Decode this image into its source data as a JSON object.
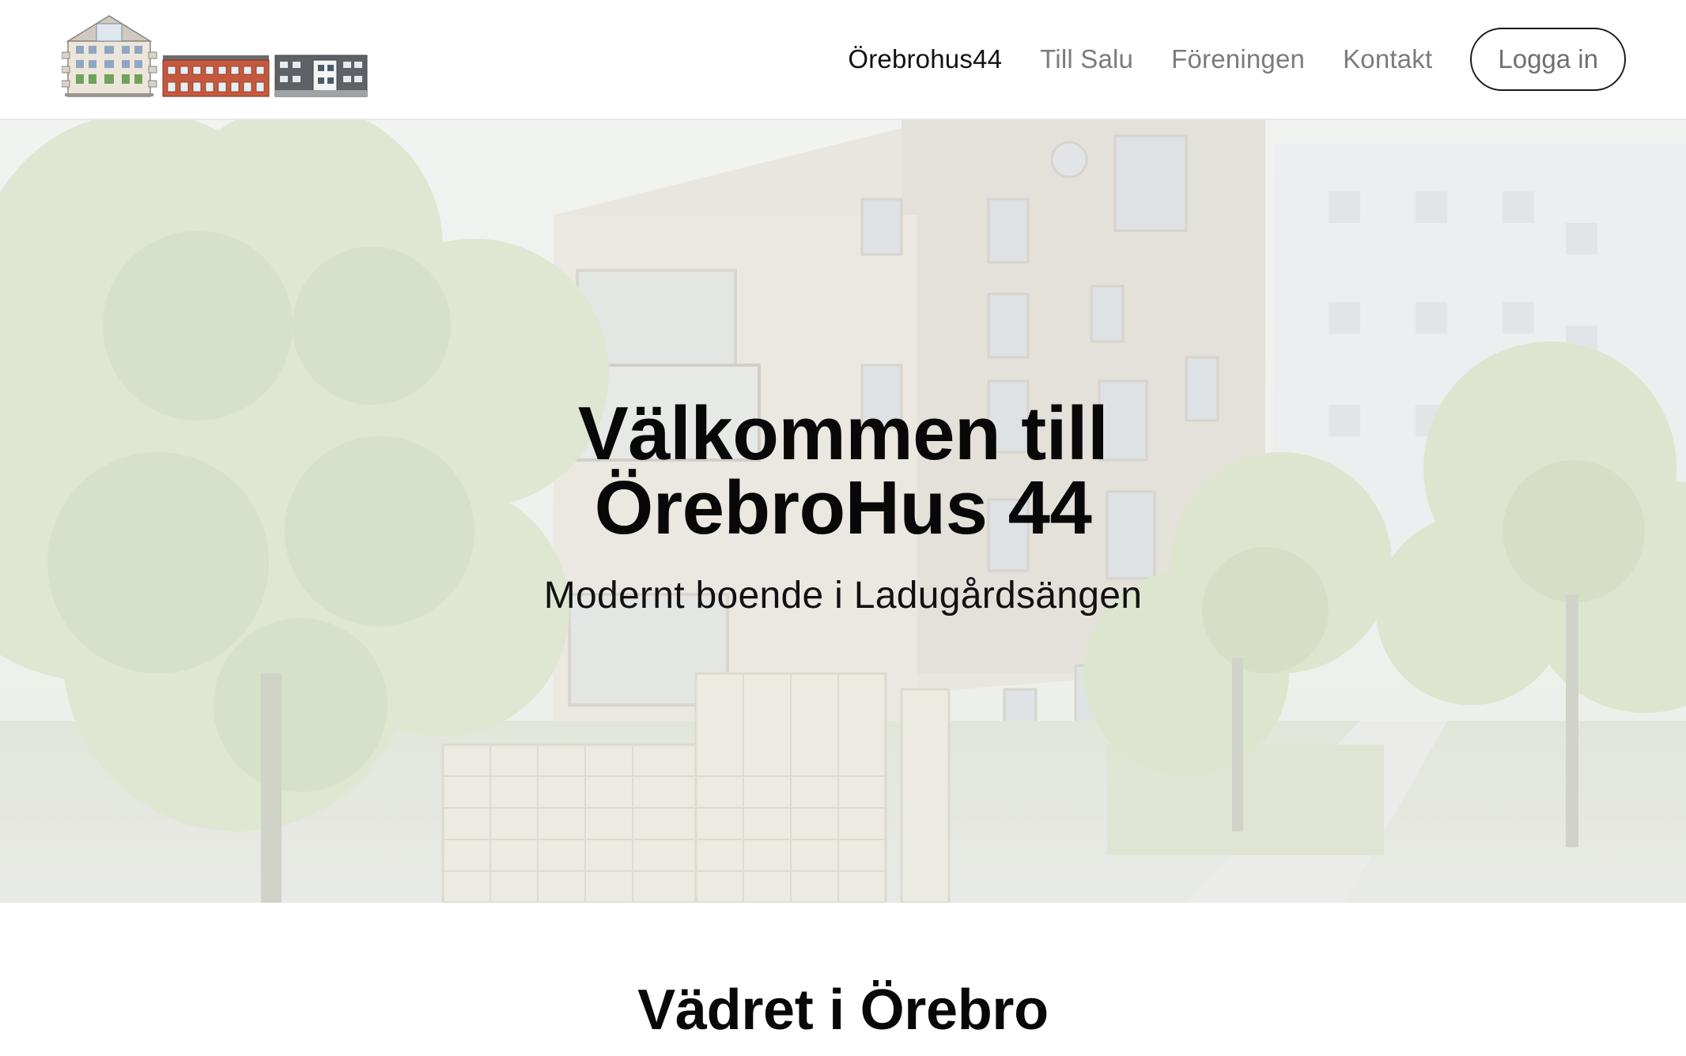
{
  "header": {
    "logo_alt": "Örebrohus44 logotyp",
    "nav": [
      {
        "label": "Örebrohus44",
        "active": true
      },
      {
        "label": "Till Salu",
        "active": false
      },
      {
        "label": "Föreningen",
        "active": false
      },
      {
        "label": "Kontakt",
        "active": false
      }
    ],
    "login_label": "Logga in"
  },
  "hero": {
    "title_line1": "Välkommen till",
    "title_line2": "ÖrebroHus 44",
    "subtitle": "Modernt boende i Ladugårdsängen"
  },
  "weather": {
    "title": "Vädret i Örebro"
  },
  "colors": {
    "text": "#080808",
    "nav_inactive": "#7b7b7b",
    "header_border": "#e6e6e6",
    "hero_overlay": "#eef0ea"
  }
}
